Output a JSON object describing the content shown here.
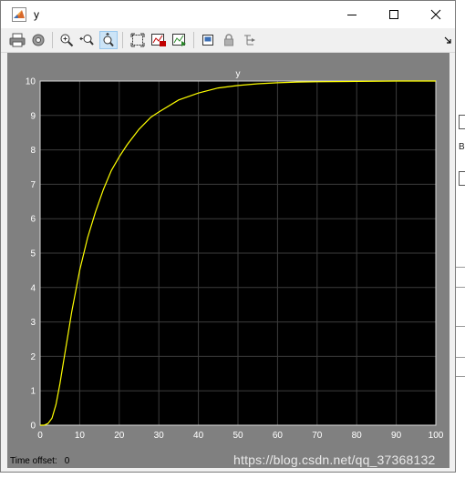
{
  "window": {
    "title": "y"
  },
  "toolbar": {
    "buttons": [
      {
        "icon": "print-icon"
      },
      {
        "icon": "settings-icon"
      },
      {
        "icon": "zoom-in-icon"
      },
      {
        "icon": "zoom-x-icon"
      },
      {
        "icon": "zoom-y-icon",
        "active": true
      },
      {
        "icon": "autoscale-icon"
      },
      {
        "icon": "save-axes-settings-icon"
      },
      {
        "icon": "restore-axes-settings-icon"
      },
      {
        "icon": "float-icon"
      },
      {
        "icon": "lock-icon"
      },
      {
        "icon": "signal-selection-icon"
      }
    ],
    "dock_icon": "dock-arrow-icon"
  },
  "status": {
    "label": "Time offset:",
    "value": "0"
  },
  "watermark": "https://blog.csdn.net/qq_37368132",
  "background_fragments": [
    "B"
  ],
  "colors": {
    "axes_bg": "#000000",
    "figure_bg": "#808080",
    "line": "#ffff00",
    "grid": "#3c3c3c",
    "text": "#ffffff"
  },
  "chart_data": {
    "type": "line",
    "title": "y",
    "xlabel": "",
    "ylabel": "",
    "xlim": [
      0,
      100
    ],
    "ylim": [
      0,
      10
    ],
    "xticks": [
      0,
      10,
      20,
      30,
      40,
      50,
      60,
      70,
      80,
      90,
      100
    ],
    "yticks": [
      0,
      1,
      2,
      3,
      4,
      5,
      6,
      7,
      8,
      9,
      10
    ],
    "grid": true,
    "series": [
      {
        "x": [
          0,
          1,
          2,
          3,
          4,
          5,
          6,
          7,
          8,
          10,
          12,
          14,
          16,
          18,
          20,
          22,
          25,
          28,
          30,
          35,
          40,
          45,
          50,
          55,
          60,
          65,
          70,
          80,
          90,
          100
        ],
        "y": [
          0,
          0.0,
          0.05,
          0.2,
          0.6,
          1.2,
          1.9,
          2.6,
          3.3,
          4.5,
          5.45,
          6.2,
          6.85,
          7.4,
          7.8,
          8.15,
          8.6,
          8.95,
          9.1,
          9.45,
          9.65,
          9.8,
          9.87,
          9.92,
          9.95,
          9.97,
          9.98,
          9.99,
          10.0,
          10.0
        ]
      }
    ]
  }
}
